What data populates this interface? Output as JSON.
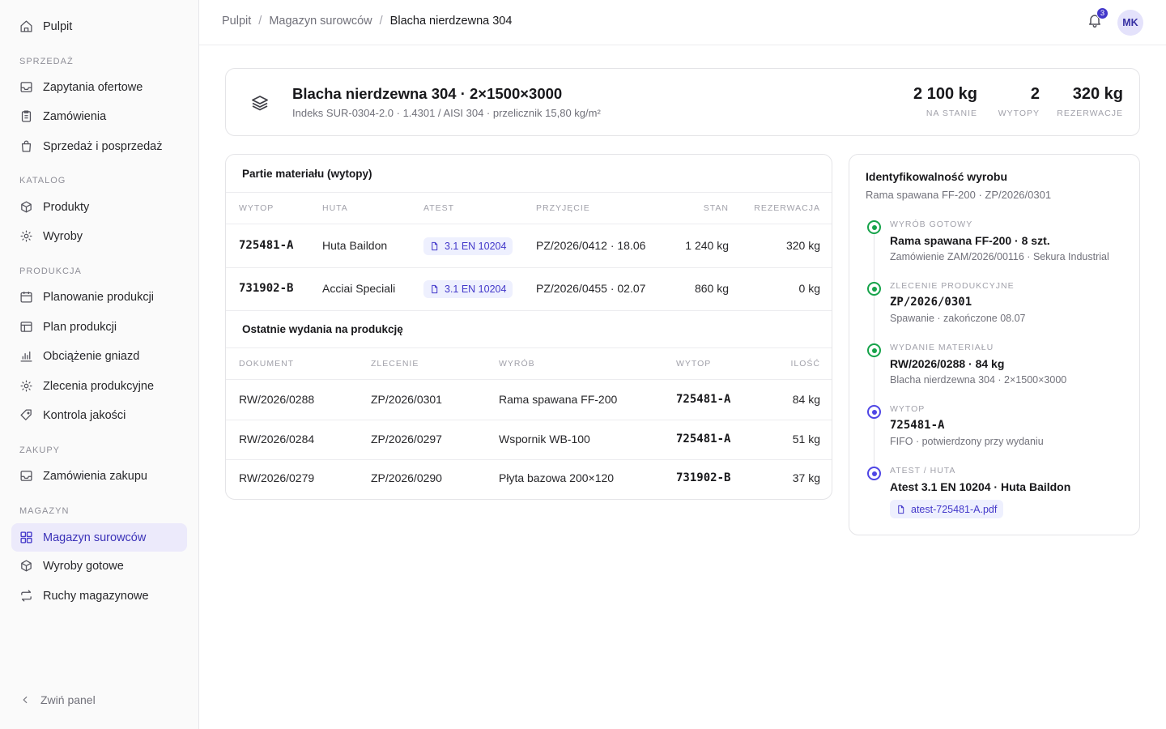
{
  "sidebar": {
    "top_item": "Pulpit",
    "sections": {
      "sales": "SPRZEDAŻ",
      "catalog": "KATALOG",
      "production": "PRODUKCJA",
      "purchase": "ZAKUPY",
      "warehouse": "MAGAZYN"
    },
    "items": {
      "inquiries": "Zapytania ofertowe",
      "orders": "Zamówienia",
      "sales_after": "Sprzedaż i posprzedaż",
      "products": "Produkty",
      "goods": "Wyroby",
      "planning": "Planowanie produkcji",
      "plan": "Plan produkcji",
      "load": "Obciążenie gniazd",
      "prod_orders": "Zlecenia produkcyjne",
      "quality": "Kontrola jakości",
      "purchase_orders": "Zamówienia zakupu",
      "raw_store": "Magazyn surowców",
      "finished": "Wyroby gotowe",
      "movements": "Ruchy magazynowe"
    },
    "collapse": "Zwiń panel",
    "accent": "#4338ca"
  },
  "topbar": {
    "breadcrumb": [
      "Pulpit",
      "Magazyn surowców",
      "Blacha nierdzewna 304"
    ],
    "separator": "/",
    "notifications": "3",
    "avatar": "MK"
  },
  "material": {
    "title": "Blacha nierdzewna 304 · 2×1500×3000",
    "subtitle": "Indeks SUR-0304-2.0 · 1.4301 / AISI 304 · przelicznik 15,80 kg/m²",
    "stats": [
      {
        "value": "2 100 kg",
        "label": "NA STANIE"
      },
      {
        "value": "2",
        "label": "WYTOPY"
      },
      {
        "value": "320 kg",
        "label": "REZERWACJE"
      }
    ]
  },
  "batches": {
    "title": "Partie materiału (wytopy)",
    "columns": [
      "WYTOP",
      "HUTA",
      "ATEST",
      "PRZYJĘCIE",
      "STAN",
      "REZERWACJA"
    ],
    "rows": [
      {
        "heat": "725481-A",
        "mill": "Huta Baildon",
        "cert": "3.1 EN 10204",
        "receipt": "PZ/2026/0412 · 18.06",
        "stock": "1 240 kg",
        "reserved": "320 kg"
      },
      {
        "heat": "731902-B",
        "mill": "Acciai Speciali",
        "cert": "3.1 EN 10204",
        "receipt": "PZ/2026/0455 · 02.07",
        "stock": "860 kg",
        "reserved": "0 kg"
      }
    ]
  },
  "issues": {
    "title": "Ostatnie wydania na produkcję",
    "columns": [
      "DOKUMENT",
      "ZLECENIE",
      "WYRÓB",
      "WYTOP",
      "ILOŚĆ"
    ],
    "rows": [
      {
        "doc": "RW/2026/0288",
        "order": "ZP/2026/0301",
        "product": "Rama spawana FF-200",
        "heat": "725481-A",
        "qty": "84 kg"
      },
      {
        "doc": "RW/2026/0284",
        "order": "ZP/2026/0297",
        "product": "Wspornik WB-100",
        "heat": "725481-A",
        "qty": "51 kg"
      },
      {
        "doc": "RW/2026/0279",
        "order": "ZP/2026/0290",
        "product": "Płyta bazowa 200×120",
        "heat": "731902-B",
        "qty": "37 kg"
      }
    ]
  },
  "trace": {
    "title": "Identyfikowalność wyrobu",
    "subtitle": "Rama spawana FF-200 · ZP/2026/0301",
    "steps": [
      {
        "kind": "WYRÓB GOTOWY",
        "value": "Rama spawana FF-200 · 8 szt.",
        "detail": "Zamówienie ZAM/2026/00116 · Sekura Industrial",
        "status": "done"
      },
      {
        "kind": "ZLECENIE PRODUKCYJNE",
        "value": "ZP/2026/0301",
        "detail": "Spawanie · zakończone 08.07",
        "status": "done"
      },
      {
        "kind": "WYDANIE MATERIAŁU",
        "value": "RW/2026/0288 · 84 kg",
        "detail": "Blacha nierdzewna 304 · 2×1500×3000",
        "status": "done"
      },
      {
        "kind": "WYTOP",
        "value": "725481-A",
        "detail": "FIFO · potwierdzony przy wydaniu",
        "status": "current"
      },
      {
        "kind": "ATEST / HUTA",
        "value": "Atest 3.1 EN 10204 · Huta Baildon",
        "detail": "",
        "status": "current"
      }
    ],
    "file": "atest-725481-A.pdf",
    "colors": {
      "done": "#16a34a",
      "current": "#4f46e5"
    }
  }
}
